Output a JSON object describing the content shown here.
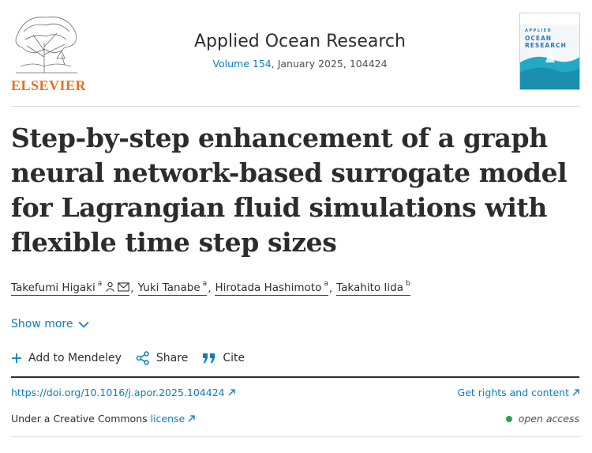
{
  "header": {
    "publisher_logo_text": "ELSEVIER",
    "journal_title": "Applied Ocean Research",
    "volume_link": "Volume 154",
    "issue_rest": ", January 2025, 104424",
    "cover_text_line1": "APPLIED",
    "cover_text_line2": "OCEAN",
    "cover_text_line3": "RESEARCH"
  },
  "article": {
    "title": "Step-by-step enhancement of a graph neural network-based surrogate model for Lagrangian fluid simulations with flexible time step sizes"
  },
  "authors": [
    {
      "name": "Takefumi Higaki",
      "sup": "a"
    },
    {
      "name": "Yuki Tanabe",
      "sup": "a"
    },
    {
      "name": "Hirotada Hashimoto",
      "sup": "a"
    },
    {
      "name": "Takahito Iida",
      "sup": "b"
    }
  ],
  "author_separator": ",",
  "show_more": "Show more",
  "actions": {
    "add_to_mendeley": "Add to Mendeley",
    "share": "Share",
    "cite": "Cite"
  },
  "links": {
    "doi": "https://doi.org/10.1016/j.apor.2025.104424",
    "rights": "Get rights and content",
    "license_prefix": "Under a Creative Commons ",
    "license_link": "license",
    "open_access": "open access"
  },
  "colors": {
    "link": "#0c7dbb",
    "elsevier_orange": "#e9711c",
    "open_access_dot": "#29a35a"
  }
}
